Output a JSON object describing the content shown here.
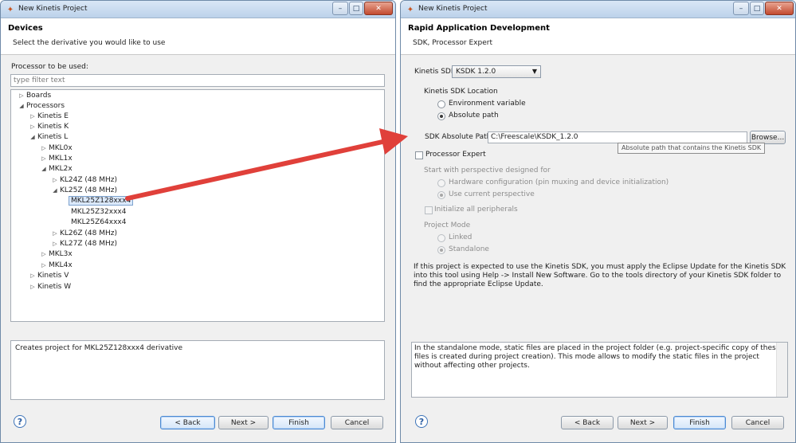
{
  "left": {
    "window_title": "New Kinetis Project",
    "header_title": "Devices",
    "header_subtitle": "Select the derivative you would like to use",
    "processor_label": "Processor to be used:",
    "filter_placeholder": "type filter text",
    "tree": [
      {
        "label": "Boards",
        "level": 0,
        "twisty": "collapsed"
      },
      {
        "label": "Processors",
        "level": 0,
        "twisty": "expanded"
      },
      {
        "label": "Kinetis E",
        "level": 1,
        "twisty": "collapsed"
      },
      {
        "label": "Kinetis K",
        "level": 1,
        "twisty": "collapsed"
      },
      {
        "label": "Kinetis L",
        "level": 1,
        "twisty": "expanded"
      },
      {
        "label": "MKL0x",
        "level": 2,
        "twisty": "collapsed"
      },
      {
        "label": "MKL1x",
        "level": 2,
        "twisty": "collapsed"
      },
      {
        "label": "MKL2x",
        "level": 2,
        "twisty": "expanded"
      },
      {
        "label": "KL24Z (48 MHz)",
        "level": 3,
        "twisty": "collapsed"
      },
      {
        "label": "KL25Z (48 MHz)",
        "level": 3,
        "twisty": "expanded"
      },
      {
        "label": "MKL25Z128xxx4",
        "level": 4,
        "twisty": "none",
        "selected": true
      },
      {
        "label": "MKL25Z32xxx4",
        "level": 4,
        "twisty": "none"
      },
      {
        "label": "MKL25Z64xxx4",
        "level": 4,
        "twisty": "none"
      },
      {
        "label": "KL26Z (48 MHz)",
        "level": 3,
        "twisty": "collapsed"
      },
      {
        "label": "KL27Z (48 MHz)",
        "level": 3,
        "twisty": "collapsed"
      },
      {
        "label": "MKL3x",
        "level": 2,
        "twisty": "collapsed"
      },
      {
        "label": "MKL4x",
        "level": 2,
        "twisty": "collapsed"
      },
      {
        "label": "Kinetis V",
        "level": 1,
        "twisty": "collapsed"
      },
      {
        "label": "Kinetis W",
        "level": 1,
        "twisty": "collapsed"
      }
    ],
    "description": "Creates project for MKL25Z128xxx4 derivative",
    "buttons": {
      "help": "?",
      "back": "< Back",
      "next": "Next >",
      "finish": "Finish",
      "cancel": "Cancel"
    }
  },
  "right": {
    "window_title": "New Kinetis Project",
    "header_title": "Rapid Application Development",
    "header_subtitle": "SDK, Processor Expert",
    "sdk_label": "Kinetis SDK",
    "sdk_value": "KSDK 1.2.0",
    "sdk_location_label": "Kinetis SDK Location",
    "radio_env": "Environment variable",
    "radio_abs": "Absolute path",
    "abs_path_label": "SDK Absolute Path",
    "abs_path_value": "C:\\Freescale\\KSDK_1.2.0",
    "browse": "Browse...",
    "tooltip": "Absolute path that contains the Kinetis SDK",
    "processor_expert": "Processor Expert",
    "perspective_label": "Start with perspective designed for",
    "radio_hw": "Hardware configuration (pin muxing and device initialization)",
    "radio_current": "Use current perspective",
    "init_peripherals": "Initialize all peripherals",
    "project_mode_label": "Project Mode",
    "radio_linked": "Linked",
    "radio_standalone": "Standalone",
    "paragraph": "If this project is expected to use the Kinetis SDK, you must apply the Eclipse Update for the Kinetis SDK into this tool using Help -> Install New Software. Go to the tools directory of your Kinetis SDK folder to find the appropriate Eclipse Update.",
    "info": "In the standalone mode, static files are placed in the project folder (e.g.  project-specific copy of these files is created during project creation). This mode allows to modify the static files in the project without affecting other projects.",
    "buttons": {
      "help": "?",
      "back": "< Back",
      "next": "Next >",
      "finish": "Finish",
      "cancel": "Cancel"
    }
  },
  "window_controls": {
    "minimize": "–",
    "maximize": "□",
    "close": "✕"
  },
  "colors": {
    "arrow": "#e0403a",
    "selection": "#dbe9fb",
    "accent": "#4b8ad3"
  }
}
